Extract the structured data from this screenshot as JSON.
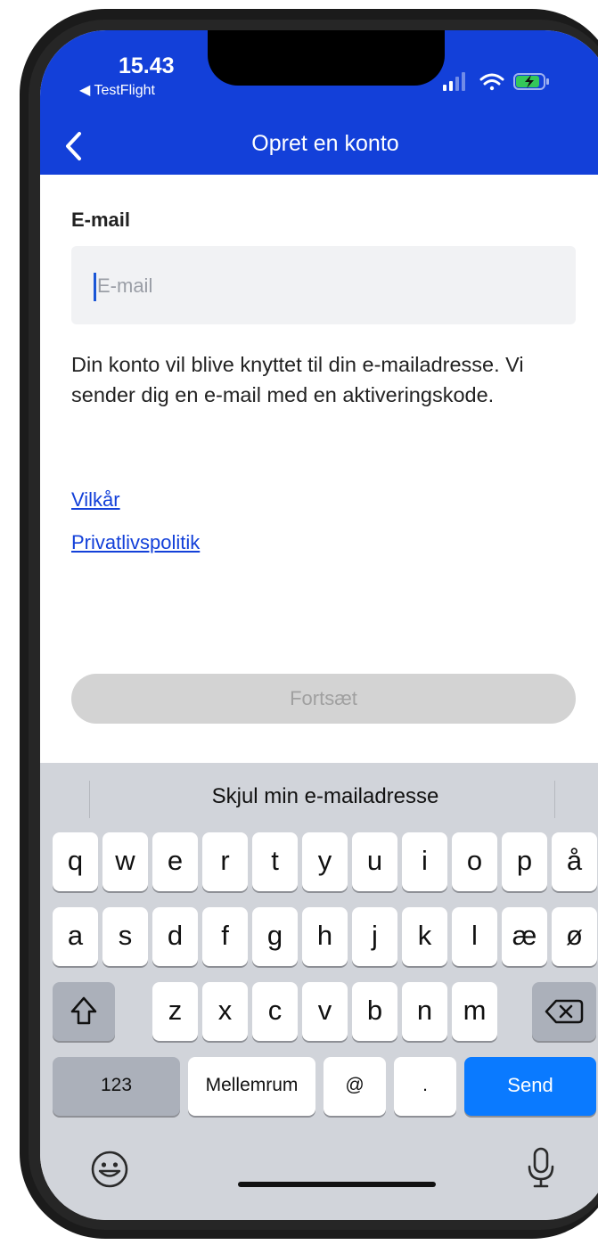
{
  "status_bar": {
    "time": "15.43",
    "back_app": "◀ TestFlight",
    "icons": [
      "signal-icon",
      "wifi-icon",
      "battery-charging-icon"
    ]
  },
  "nav": {
    "title": "Opret en konto",
    "back_icon": "chevron-left-icon"
  },
  "form": {
    "email_label": "E-mail",
    "email_placeholder": "E-mail",
    "email_value": "",
    "info_text": "Din konto vil blive knyttet til din e-mailadresse. Vi sender dig en e-mail med en aktiveringskode.",
    "terms_link": "Vilkår",
    "privacy_link": "Privatlivspolitik",
    "continue_label": "Fortsæt"
  },
  "keyboard": {
    "suggestion": "Skjul min e-mailadresse",
    "row1": [
      "q",
      "w",
      "e",
      "r",
      "t",
      "y",
      "u",
      "i",
      "o",
      "p",
      "å"
    ],
    "row2": [
      "a",
      "s",
      "d",
      "f",
      "g",
      "h",
      "j",
      "k",
      "l",
      "æ",
      "ø"
    ],
    "row3": [
      "z",
      "x",
      "c",
      "v",
      "b",
      "n",
      "m"
    ],
    "numbers_key": "123",
    "space_key": "Mellemrum",
    "at_key": "@",
    "dot_key": ".",
    "send_key": "Send",
    "icons": [
      "shift-icon",
      "backspace-icon",
      "emoji-icon",
      "microphone-icon"
    ]
  },
  "colors": {
    "brand_blue": "#1340d9",
    "send_blue": "#0a7aff"
  }
}
